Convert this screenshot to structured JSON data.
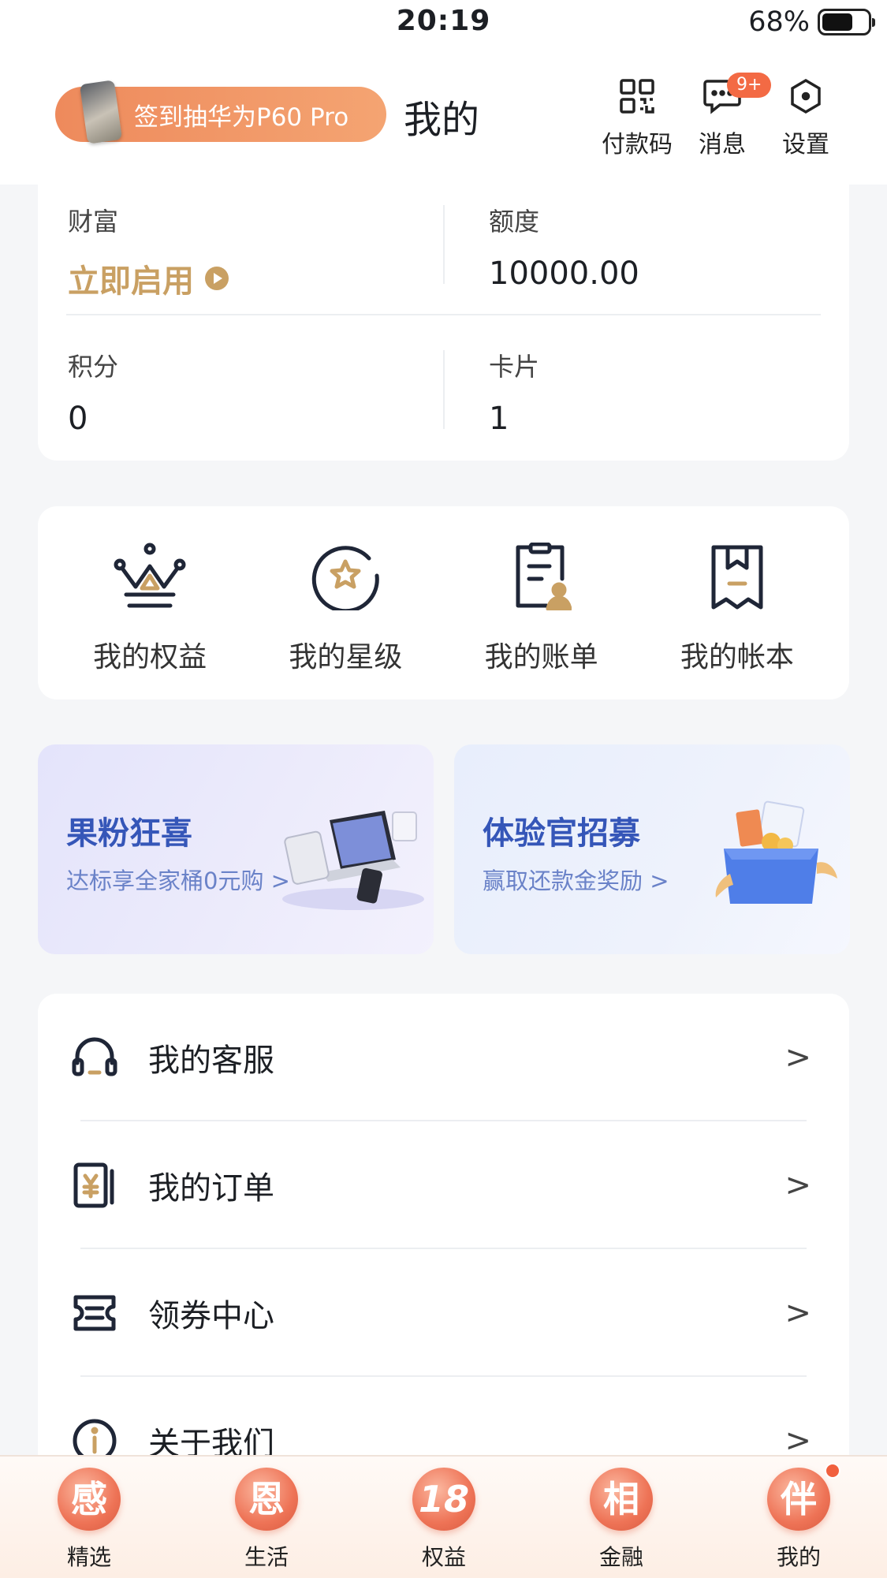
{
  "status_bar": {
    "time": "20:19",
    "battery": "68%",
    "battery_level": 0.68
  },
  "header": {
    "promo": "签到抽华为P60 Pro",
    "title": "我的",
    "actions": [
      {
        "label": "付款码",
        "icon": "qr-code-icon"
      },
      {
        "label": "消息",
        "icon": "message-icon",
        "badge": "9+"
      },
      {
        "label": "设置",
        "icon": "settings-icon"
      }
    ]
  },
  "stats": {
    "wealth": {
      "label": "财富",
      "value": "立即启用"
    },
    "limit": {
      "label": "额度",
      "value": "10000.00"
    },
    "points": {
      "label": "积分",
      "value": "0"
    },
    "cards": {
      "label": "卡片",
      "value": "1"
    }
  },
  "quick": [
    {
      "label": "我的权益",
      "icon": "crown-icon"
    },
    {
      "label": "我的星级",
      "icon": "star-badge-icon"
    },
    {
      "label": "我的账单",
      "icon": "bill-icon"
    },
    {
      "label": "我的帐本",
      "icon": "bookmark-book-icon"
    }
  ],
  "banners": [
    {
      "title": "果粉狂喜",
      "subtitle": "达标享全家桶0元购",
      "arrow": ">"
    },
    {
      "title": "体验官招募",
      "subtitle": "赢取还款金奖励",
      "arrow": ">"
    }
  ],
  "menu": [
    {
      "label": "我的客服",
      "icon": "headset-icon",
      "arrow": ">"
    },
    {
      "label": "我的订单",
      "icon": "order-icon",
      "arrow": ">"
    },
    {
      "label": "领券中心",
      "icon": "coupon-icon",
      "arrow": ">"
    },
    {
      "label": "关于我们",
      "icon": "info-icon",
      "arrow": ">"
    }
  ],
  "tabs": [
    {
      "glyph": "感",
      "label": "精选"
    },
    {
      "glyph": "恩",
      "label": "生活"
    },
    {
      "glyph": "18",
      "label": "权益"
    },
    {
      "glyph": "相",
      "label": "金融"
    },
    {
      "glyph": "伴",
      "label": "我的"
    }
  ],
  "colors": {
    "gold": "#c9a063",
    "accent": "#ee7356",
    "banner_blue": "#3556b8"
  }
}
